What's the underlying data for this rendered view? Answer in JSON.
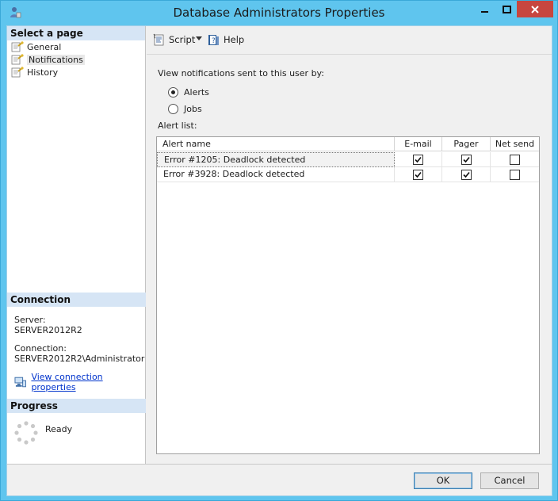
{
  "window": {
    "title": "Database Administrators Properties"
  },
  "left_pane": {
    "select_header": "Select a page",
    "pages": [
      {
        "label": "General",
        "icon": "page-wrench-icon"
      },
      {
        "label": "Notifications",
        "icon": "page-wrench-icon"
      },
      {
        "label": "History",
        "icon": "page-wrench-icon"
      }
    ],
    "connection_header": "Connection",
    "server_label": "Server:",
    "server_value": "SERVER2012R2",
    "connection_label": "Connection:",
    "connection_value": "SERVER2012R2\\Administrator",
    "view_props_link": "View connection properties",
    "progress_header": "Progress",
    "progress_status": "Ready"
  },
  "toolbar": {
    "script_label": "Script",
    "help_label": "Help"
  },
  "main": {
    "notify_label": "View notifications sent to this user by:",
    "radio_alerts": "Alerts",
    "radio_jobs": "Jobs",
    "selected_radio": "Alerts",
    "alert_list_label": "Alert list:",
    "columns": [
      "Alert name",
      "E-mail",
      "Pager",
      "Net send"
    ],
    "rows": [
      {
        "name": "Error #1205: Deadlock detected",
        "email": true,
        "pager": true,
        "net_send": false
      },
      {
        "name": "Error #3928: Deadlock detected",
        "email": true,
        "pager": true,
        "net_send": false
      }
    ]
  },
  "footer": {
    "ok_label": "OK",
    "cancel_label": "Cancel"
  },
  "colors": {
    "frame": "#5fc5ee",
    "close_button": "#c7463f",
    "section_header": "#d6e5f5",
    "link": "#0033cc"
  }
}
